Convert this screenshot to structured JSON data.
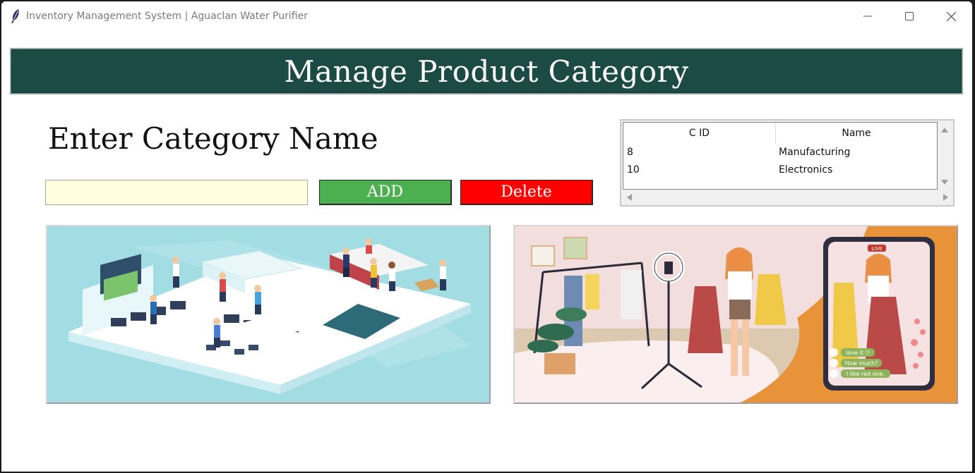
{
  "window": {
    "title": "Inventory Management System | Aguaclan Water Purifier",
    "icon": "feather-icon"
  },
  "header": {
    "title": "Manage Product Category",
    "background": "#1c4b45"
  },
  "form": {
    "label": "Enter Category Name",
    "input_value": "",
    "input_background": "#ffffe0",
    "add_label": "ADD",
    "delete_label": "Delete",
    "add_color": "#4caf50",
    "delete_color": "#ff0000"
  },
  "table": {
    "columns": [
      "C ID",
      "Name"
    ],
    "rows": [
      {
        "id": "8",
        "name": "Manufacturing"
      },
      {
        "id": "10",
        "name": "Electronics"
      }
    ]
  },
  "images": {
    "right_phone": {
      "live_badge": "LIVE",
      "comments": [
        "love it !!",
        "How much?",
        "I like red one."
      ]
    }
  }
}
